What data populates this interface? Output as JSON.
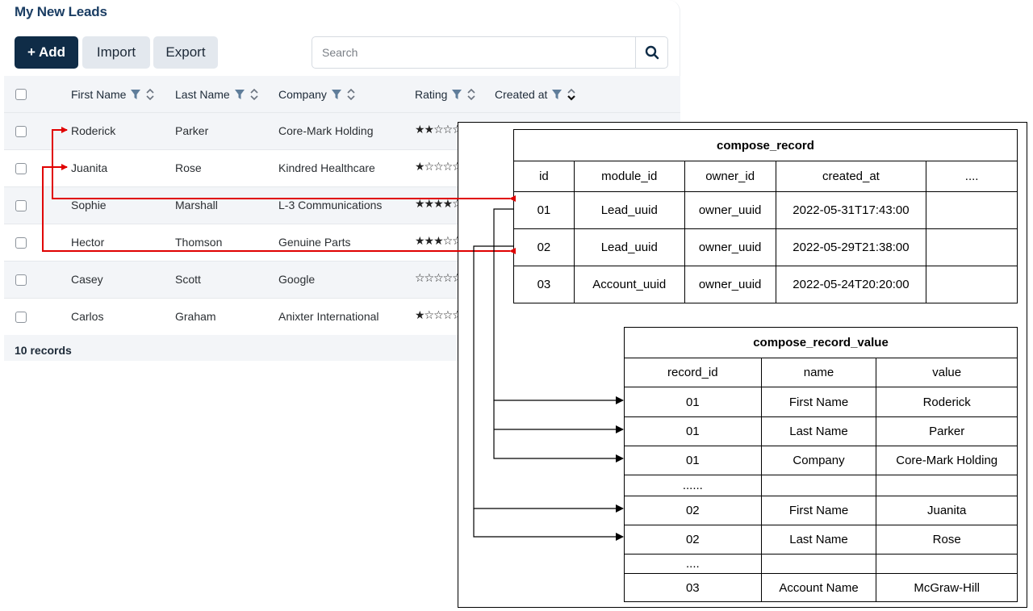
{
  "leads": {
    "title": "My New Leads",
    "buttons": {
      "add": "+ Add",
      "import": "Import",
      "export": "Export"
    },
    "search_placeholder": "Search",
    "columns": [
      "First Name",
      "Last Name",
      "Company",
      "Rating",
      "Created at"
    ],
    "rows": [
      {
        "first": "Roderick",
        "last": "Parker",
        "company": "Core-Mark Holding",
        "rating_text": "★★☆☆☆",
        "rating": 2
      },
      {
        "first": "Juanita",
        "last": "Rose",
        "company": "Kindred Healthcare",
        "rating_text": "★☆☆☆☆",
        "rating": 1
      },
      {
        "first": "Sophie",
        "last": "Marshall",
        "company": "L-3 Communications",
        "rating_text": "★★★★☆",
        "rating": 4
      },
      {
        "first": "Hector",
        "last": "Thomson",
        "company": "Genuine Parts",
        "rating_text": "★★★☆☆",
        "rating": 3
      },
      {
        "first": "Casey",
        "last": "Scott",
        "company": "Google",
        "rating_text": "☆☆☆☆☆",
        "rating": 0
      },
      {
        "first": "Carlos",
        "last": "Graham",
        "company": "Anixter International",
        "rating_text": "★☆☆☆☆",
        "rating": 1
      }
    ],
    "footer": "10 records"
  },
  "compose_record": {
    "title": "compose_record",
    "headers": [
      "id",
      "module_id",
      "owner_id",
      "created_at",
      "...."
    ],
    "rows": [
      [
        "01",
        "Lead_uuid",
        "owner_uuid",
        "2022-05-31T17:43:00",
        ""
      ],
      [
        "02",
        "Lead_uuid",
        "owner_uuid",
        "2022-05-29T21:38:00",
        ""
      ],
      [
        "03",
        "Account_uuid",
        "owner_uuid",
        "2022-05-24T20:20:00",
        ""
      ]
    ]
  },
  "compose_record_value": {
    "title": "compose_record_value",
    "headers": [
      "record_id",
      "name",
      "value"
    ],
    "rows": [
      [
        "01",
        "First Name",
        "Roderick"
      ],
      [
        "01",
        "Last Name",
        "Parker"
      ],
      [
        "01",
        "Company",
        "Core-Mark Holding"
      ],
      [
        "......",
        "",
        ""
      ],
      [
        "02",
        "First Name",
        "Juanita"
      ],
      [
        "02",
        "Last Name",
        "Rose"
      ],
      [
        "....",
        "",
        ""
      ],
      [
        "03",
        "Account Name",
        "McGraw-Hill"
      ]
    ]
  },
  "colors": {
    "accent": "#0f2c47",
    "title": "#1a3d63",
    "link_arrow": "#e00000",
    "diagram_line": "#000000"
  }
}
